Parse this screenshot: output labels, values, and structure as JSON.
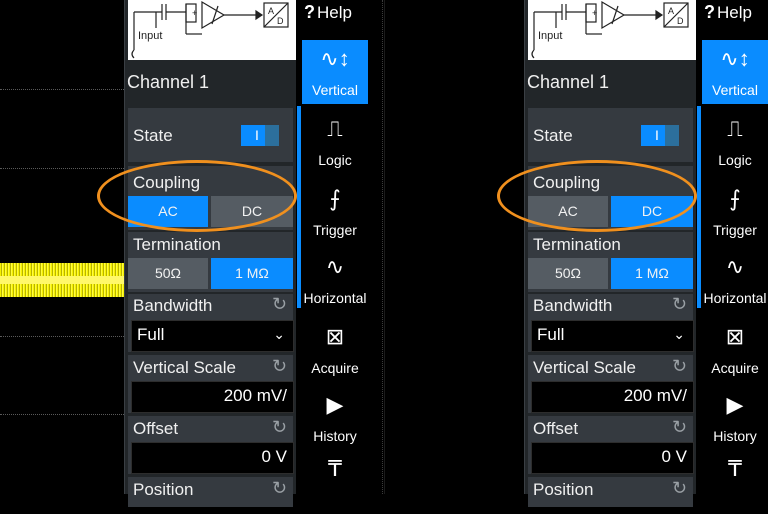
{
  "help_label": "Help",
  "schematic_input_label": "Input",
  "panels": [
    {
      "channel_title": "Channel 1",
      "state_label": "State",
      "state_toggle_text": "I",
      "coupling_label": "Coupling",
      "coupling_options": [
        "AC",
        "DC"
      ],
      "coupling_selected": "AC",
      "termination_label": "Termination",
      "termination_options": [
        "50Ω",
        "1 MΩ"
      ],
      "termination_selected": "1 MΩ",
      "bandwidth_label": "Bandwidth",
      "bandwidth_value": "Full",
      "vertical_scale_label": "Vertical Scale",
      "vertical_scale_value": "200 mV/",
      "offset_label": "Offset",
      "offset_value": "0 V",
      "position_label": "Position"
    },
    {
      "channel_title": "Channel 1",
      "state_label": "State",
      "state_toggle_text": "I",
      "coupling_label": "Coupling",
      "coupling_options": [
        "AC",
        "DC"
      ],
      "coupling_selected": "DC",
      "termination_label": "Termination",
      "termination_options": [
        "50Ω",
        "1 MΩ"
      ],
      "termination_selected": "1 MΩ",
      "bandwidth_label": "Bandwidth",
      "bandwidth_value": "Full",
      "vertical_scale_label": "Vertical Scale",
      "vertical_scale_value": "200 mV/",
      "offset_label": "Offset",
      "offset_value": "0 V",
      "position_label": "Position"
    }
  ],
  "sidebar_tabs": [
    {
      "label": "Vertical",
      "icon": "vertical-scale-icon",
      "active": true
    },
    {
      "label": "Logic",
      "icon": "logic-icon",
      "active": false
    },
    {
      "label": "Trigger",
      "icon": "trigger-icon",
      "active": false
    },
    {
      "label": "Horizontal",
      "icon": "horizontal-icon",
      "active": false
    },
    {
      "label": "Acquire",
      "icon": "acquire-icon",
      "active": false
    },
    {
      "label": "History",
      "icon": "play-icon",
      "active": false
    }
  ],
  "colors": {
    "accent": "#0a8cff",
    "highlight_ring": "#f0901e",
    "trace": "#f6f000",
    "panel_bg": "#222629"
  }
}
